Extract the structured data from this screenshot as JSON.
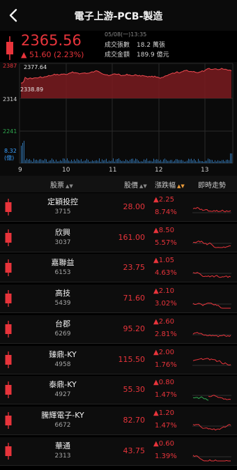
{
  "header": {
    "title": "電子上游-PCB-製造"
  },
  "quote": {
    "price": "2365.56",
    "change": "▲ 51.60 (2.23%)",
    "date": "05/08(一)13:35",
    "stats": [
      {
        "label": "成交張數",
        "value": "18.2 萬張"
      },
      {
        "label": "成交金額",
        "value": "189.9 億元"
      }
    ]
  },
  "chart": {
    "high_label": "2377.64",
    "low_label": "2338.89",
    "y_labels": [
      "2387",
      "2314",
      "2241"
    ],
    "volume_label": "8.32",
    "volume_unit": "(億)",
    "x_labels": [
      "9",
      "10",
      "11",
      "12",
      "13"
    ],
    "colors": {
      "up": "#e8343b",
      "down": "#2fa84f",
      "avg": "#3aa0ff",
      "volume": "#2f6fa8"
    }
  },
  "list": {
    "headers": {
      "stock": "股票",
      "price": "股價",
      "change": "漲跌幅",
      "trend": "即時走勢"
    },
    "rows": [
      {
        "name": "定穎投控",
        "code": "3715",
        "price": "28.00",
        "change": "▲2.25",
        "pct": "8.74%",
        "trend_color": "#e8343b",
        "mixed": false
      },
      {
        "name": "欣興",
        "code": "3037",
        "price": "161.00",
        "change": "▲8.50",
        "pct": "5.57%",
        "trend_color": "#e8343b",
        "mixed": false
      },
      {
        "name": "嘉聯益",
        "code": "6153",
        "price": "23.75",
        "change": "▲1.05",
        "pct": "4.63%",
        "trend_color": "#e8343b",
        "mixed": false
      },
      {
        "name": "高技",
        "code": "5439",
        "price": "71.60",
        "change": "▲2.10",
        "pct": "3.02%",
        "trend_color": "#e8343b",
        "mixed": false
      },
      {
        "name": "台郡",
        "code": "6269",
        "price": "95.20",
        "change": "▲2.60",
        "pct": "2.81%",
        "trend_color": "#e8343b",
        "mixed": false
      },
      {
        "name": "臻鼎-KY",
        "code": "4958",
        "price": "115.50",
        "change": "▲2.00",
        "pct": "1.76%",
        "trend_color": "#e8343b",
        "mixed": false
      },
      {
        "name": "泰鼎-KY",
        "code": "4927",
        "price": "55.30",
        "change": "▲0.80",
        "pct": "1.47%",
        "trend_color": "#e8343b",
        "mixed": true
      },
      {
        "name": "騰輝電子-KY",
        "code": "6672",
        "price": "82.70",
        "change": "▲1.20",
        "pct": "1.47%",
        "trend_color": "#e8343b",
        "mixed": false
      },
      {
        "name": "華通",
        "code": "2313",
        "price": "43.75",
        "change": "▲0.60",
        "pct": "1.39%",
        "trend_color": "#e8343b",
        "mixed": false
      }
    ]
  }
}
